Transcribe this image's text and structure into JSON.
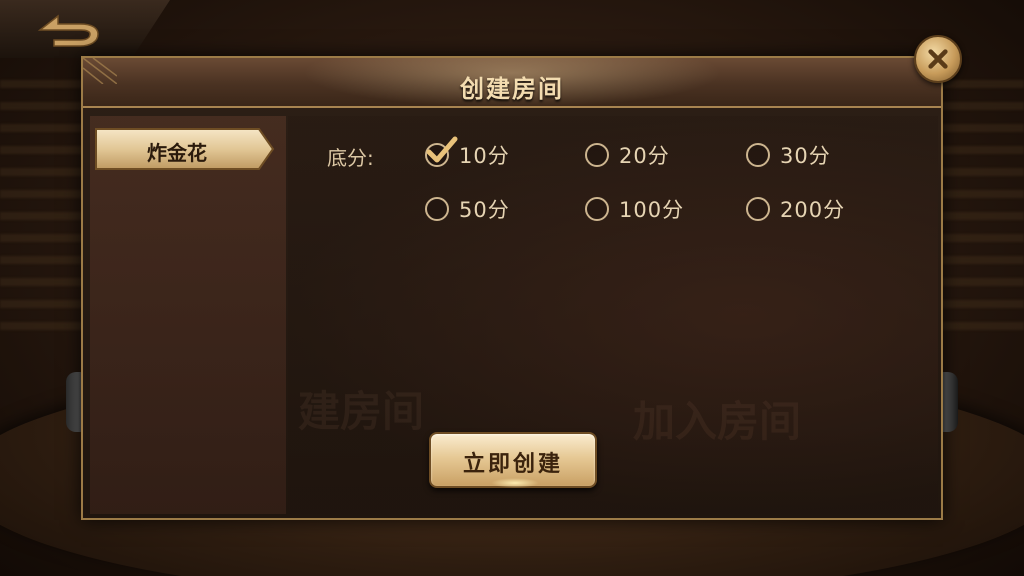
{
  "dialog": {
    "title": "创建房间",
    "close_icon": "close-icon"
  },
  "back_button": {
    "icon": "back-arrow-icon"
  },
  "sidebar": {
    "items": [
      {
        "label": "炸金花",
        "selected": true
      }
    ]
  },
  "settings": {
    "score_label": "底分:",
    "options": [
      {
        "label": "10分",
        "selected": true
      },
      {
        "label": "20分",
        "selected": false
      },
      {
        "label": "30分",
        "selected": false
      },
      {
        "label": "50分",
        "selected": false
      },
      {
        "label": "100分",
        "selected": false
      },
      {
        "label": "200分",
        "selected": false
      }
    ]
  },
  "actions": {
    "create_label": "立即创建"
  },
  "watermarks": {
    "left": "建房间",
    "right": "加入房间"
  },
  "colors": {
    "gold": "#c9a064",
    "frame": "#9c7b47",
    "text": "#e6d4b3"
  }
}
